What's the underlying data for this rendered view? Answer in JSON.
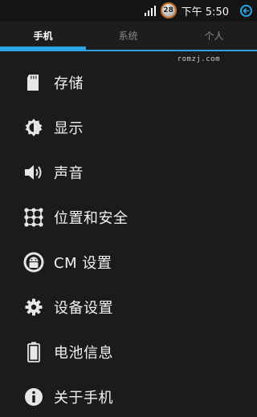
{
  "status_bar": {
    "badge": "28",
    "time": "下午 5:50"
  },
  "tabs": [
    {
      "label": "手机",
      "active": true
    },
    {
      "label": "系统",
      "active": false
    },
    {
      "label": "个人",
      "active": false
    }
  ],
  "watermark": "romzj.com",
  "menu": [
    {
      "label": "存储",
      "icon": "sd-card-icon"
    },
    {
      "label": "显示",
      "icon": "brightness-icon"
    },
    {
      "label": "声音",
      "icon": "speaker-icon"
    },
    {
      "label": "位置和安全",
      "icon": "pattern-lock-icon"
    },
    {
      "label": "CM 设置",
      "icon": "cyanogen-android-icon"
    },
    {
      "label": "设备设置",
      "icon": "gear-icon"
    },
    {
      "label": "电池信息",
      "icon": "battery-icon"
    },
    {
      "label": "关于手机",
      "icon": "info-icon"
    }
  ],
  "colors": {
    "accent": "#2ea6e6",
    "background": "#1b1b1b"
  }
}
